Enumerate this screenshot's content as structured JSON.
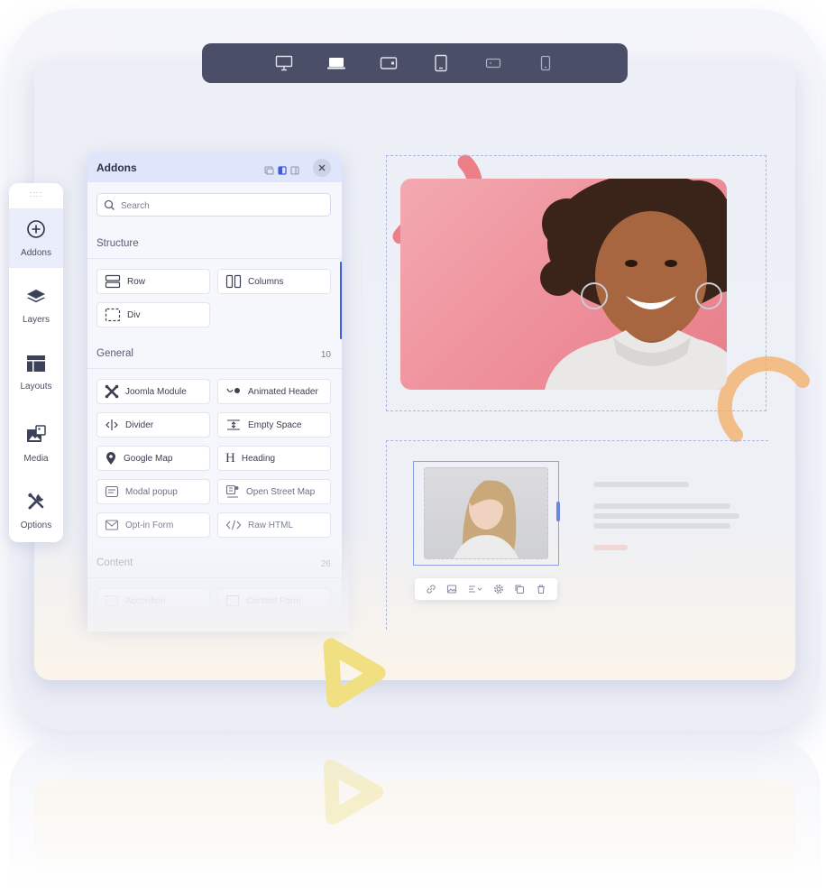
{
  "device_bar": {
    "icons": [
      "desktop-icon",
      "laptop-icon",
      "tablet-landscape-icon",
      "tablet-icon",
      "mobile-landscape-icon",
      "mobile-icon"
    ]
  },
  "sidebar": {
    "items": [
      {
        "label": "Addons",
        "icon": "plus-circle-icon"
      },
      {
        "label": "Layers",
        "icon": "layers-icon"
      },
      {
        "label": "Layouts",
        "icon": "layouts-icon"
      },
      {
        "label": "Media",
        "icon": "media-icon"
      },
      {
        "label": "Options",
        "icon": "tools-icon"
      }
    ]
  },
  "addons_panel": {
    "title": "Addons",
    "search_placeholder": "Search",
    "structure": {
      "label": "Structure",
      "items": [
        "Row",
        "Columns",
        "Div"
      ]
    },
    "general": {
      "label": "General",
      "count": "10",
      "items": [
        "Joomla Module",
        "Animated Header",
        "Divider",
        "Empty Space",
        "Google Map",
        "Heading",
        "Modal popup",
        "Open Street Map",
        "Opt-in Form",
        "Raw HTML"
      ]
    },
    "content": {
      "label": "Content",
      "count": "26",
      "items": [
        "Accordion",
        "Contact Form"
      ]
    }
  },
  "colors": {
    "device_bar": "#4a4e66",
    "accent": "#3d5bdc",
    "hero_bg": "#ee8f9a",
    "coral_shape": "#ef7f86",
    "orange_arc": "#f2bd86",
    "yellow_triangle": "#f1e082"
  }
}
